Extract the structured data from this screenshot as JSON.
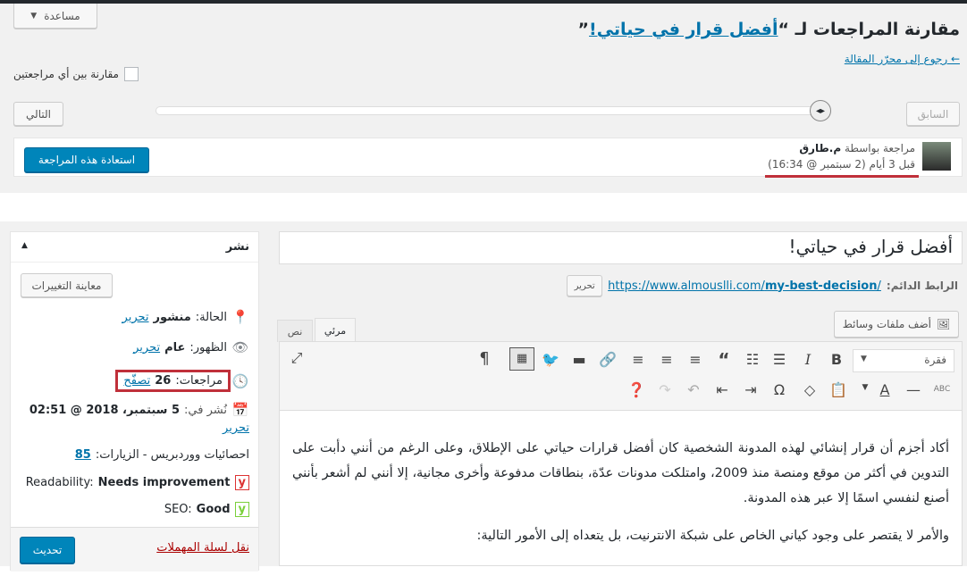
{
  "revisions": {
    "help_tab": "مساعدة",
    "title_prefix": "مقارنة المراجعات لـ “",
    "title_link": "أفضل قرار في حياتي!",
    "title_suffix": "”",
    "back_link": "← رجوع إلى محرّر المقالة",
    "compare_any_label": "مقارنة بين أي مراجعتين",
    "previous_button": "السابق",
    "next_button": "التالي",
    "revision_by": "مراجعة بواسطة",
    "author": "م.طارق",
    "revision_time": "قبل 3 أيام (2 سبتمبر @ 16:34)",
    "restore_button": "استعادة هذه المراجعة"
  },
  "publish": {
    "title": "نشر",
    "preview_button": "معاينة التغييرات",
    "status_label": "الحالة:",
    "status_value": "منشور",
    "visibility_label": "الظهور:",
    "visibility_value": "عام",
    "revisions_label": "مراجعات:",
    "revisions_count": "26",
    "browse_link": "تصفّح",
    "published_label": "نُشر في:",
    "published_value": "5 سبتمبر، 2018 @ 02:51",
    "edit_link": "تحرير",
    "stats_label": "احصائيات ووردبريس - الزيارات:",
    "stats_value": "85",
    "readability_label": "Readability:",
    "readability_value": "Needs improvement",
    "seo_label": "SEO:",
    "seo_value": "Good",
    "trash_link": "نقل لسلة المهملات",
    "update_button": "تحديث"
  },
  "editor": {
    "post_title": "أفضل قرار في حياتي!",
    "permalink_label": "الرابط الدائم:",
    "permalink_base": "https://www.almouslli.com/",
    "permalink_slug": "my-best-decision",
    "permalink_end": "/",
    "permalink_edit": "تحرير",
    "add_media": "أضف ملفات وسائط",
    "tab_visual": "مرئي",
    "tab_text": "نص",
    "format_select": "فقرة",
    "paragraph1": "أكاد أجزم أن قرار إنشائي لهذه المدونة الشخصية كان أفضل قرارات حياتي على الإطلاق، وعلى الرغم من أنني دأبت على التدوين في أكثر من موقع ومنصة منذ 2009، وامتلكت مدونات عدّة، بنطاقات مدفوعة وأخرى مجانية، إلا أنني لم أشعر بأنني أصنع لنفسي اسمًا إلا عبر هذه المدونة.",
    "paragraph2": "والأمر لا يقتصر على وجود كياني الخاص على شبكة الانترنيت، بل يتعداه إلى الأمور التالية:"
  },
  "colors": {
    "primary": "#0085ba",
    "highlight": "#c0303a",
    "link": "#0073aa"
  }
}
